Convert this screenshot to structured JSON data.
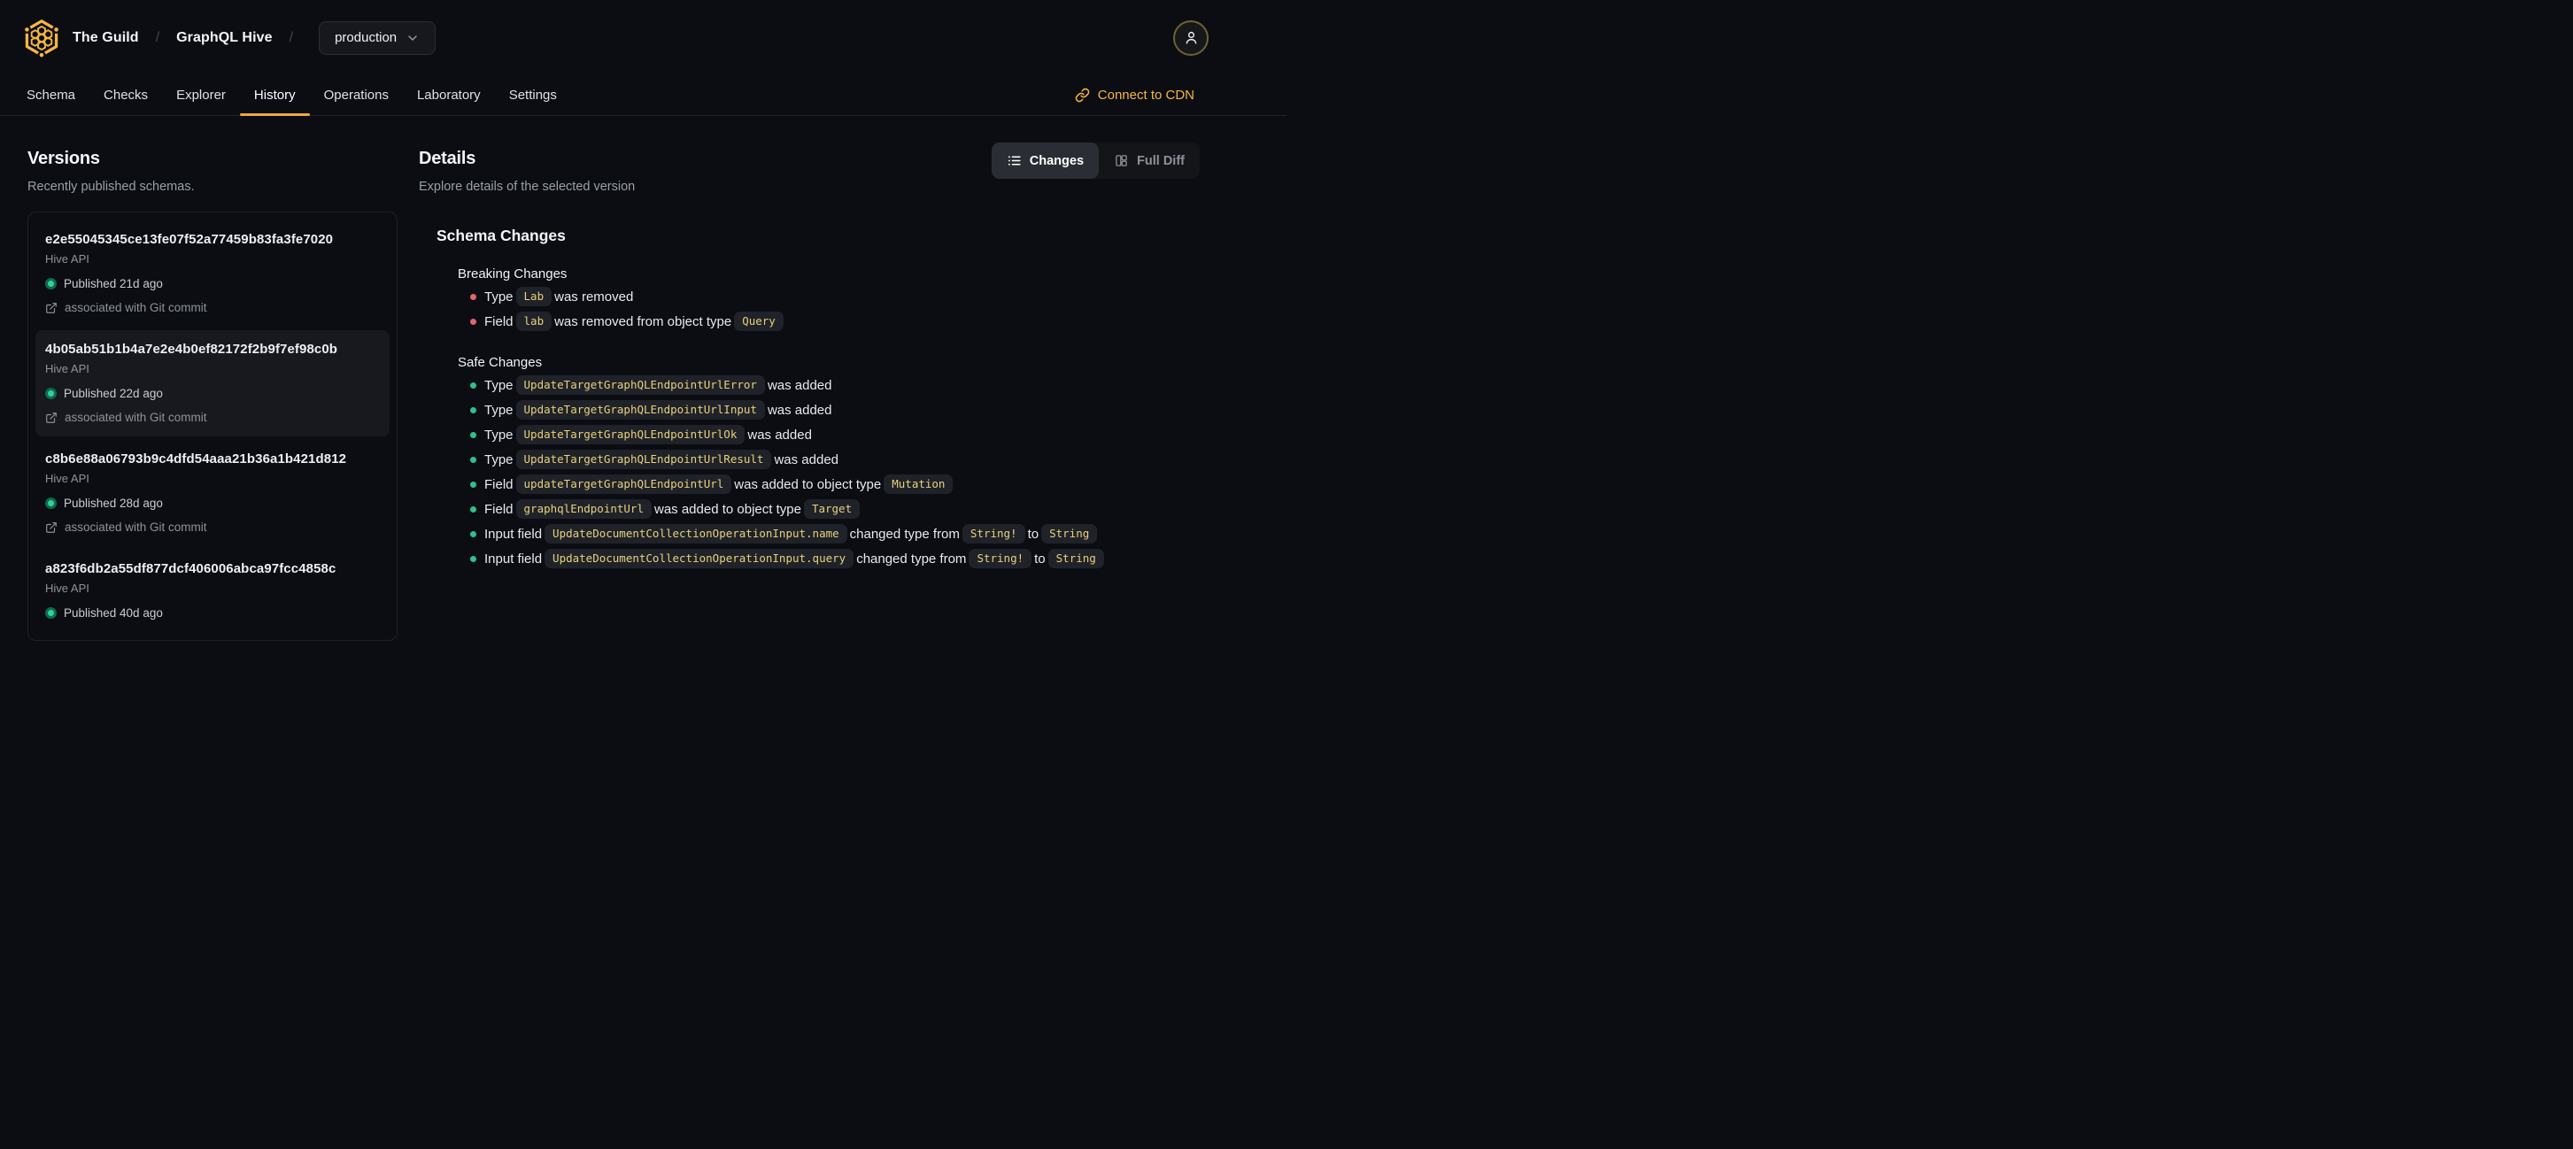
{
  "brand": {
    "org": "The Guild",
    "project": "GraphQL Hive",
    "target": "production",
    "separator": "/"
  },
  "tabs": [
    {
      "label": "Schema"
    },
    {
      "label": "Checks"
    },
    {
      "label": "Explorer"
    },
    {
      "label": "History",
      "active": true
    },
    {
      "label": "Operations"
    },
    {
      "label": "Laboratory"
    },
    {
      "label": "Settings"
    }
  ],
  "cdn_link": {
    "label": "Connect to CDN"
  },
  "versions_panel": {
    "title": "Versions",
    "subtitle": "Recently published schemas.",
    "items": [
      {
        "hash": "e2e55045345ce13fe07f52a77459b83fa3fe7020",
        "service": "Hive API",
        "published": "Published 21d ago",
        "git": "associated with Git commit",
        "selected": false
      },
      {
        "hash": "4b05ab51b1b4a7e2e4b0ef82172f2b9f7ef98c0b",
        "service": "Hive API",
        "published": "Published 22d ago",
        "git": "associated with Git commit",
        "selected": true
      },
      {
        "hash": "c8b6e88a06793b9c4dfd54aaa21b36a1b421d812",
        "service": "Hive API",
        "published": "Published 28d ago",
        "git": "associated with Git commit",
        "selected": false
      },
      {
        "hash": "a823f6db2a55df877dcf406006abca97fcc4858c",
        "service": "Hive API",
        "published": "Published 40d ago",
        "git": null,
        "selected": false
      }
    ]
  },
  "details_panel": {
    "title": "Details",
    "subtitle": "Explore details of the selected version",
    "view_toggle": [
      {
        "label": "Changes",
        "icon": "list-icon",
        "active": true
      },
      {
        "label": "Full Diff",
        "icon": "columns-icon",
        "active": false
      }
    ],
    "schema_changes": {
      "title": "Schema Changes",
      "sections": [
        {
          "title": "Breaking Changes",
          "kind": "breaking",
          "items": [
            [
              {
                "text": "Type "
              },
              {
                "code": "Lab"
              },
              {
                "text": " was removed"
              }
            ],
            [
              {
                "text": "Field "
              },
              {
                "code": "lab"
              },
              {
                "text": " was removed from object type "
              },
              {
                "code": "Query"
              }
            ]
          ]
        },
        {
          "title": "Safe Changes",
          "kind": "safe",
          "items": [
            [
              {
                "text": "Type "
              },
              {
                "code": "UpdateTargetGraphQLEndpointUrlError"
              },
              {
                "text": " was added"
              }
            ],
            [
              {
                "text": "Type "
              },
              {
                "code": "UpdateTargetGraphQLEndpointUrlInput"
              },
              {
                "text": " was added"
              }
            ],
            [
              {
                "text": "Type "
              },
              {
                "code": "UpdateTargetGraphQLEndpointUrlOk"
              },
              {
                "text": " was added"
              }
            ],
            [
              {
                "text": "Type "
              },
              {
                "code": "UpdateTargetGraphQLEndpointUrlResult"
              },
              {
                "text": " was added"
              }
            ],
            [
              {
                "text": "Field "
              },
              {
                "code": "updateTargetGraphQLEndpointUrl"
              },
              {
                "text": " was added to object type "
              },
              {
                "code": "Mutation"
              }
            ],
            [
              {
                "text": "Field "
              },
              {
                "code": "graphqlEndpointUrl"
              },
              {
                "text": " was added to object type "
              },
              {
                "code": "Target"
              }
            ],
            [
              {
                "text": "Input field "
              },
              {
                "code": "UpdateDocumentCollectionOperationInput.name"
              },
              {
                "text": " changed type from "
              },
              {
                "code": "String!"
              },
              {
                "text": " to "
              },
              {
                "code": "String"
              }
            ],
            [
              {
                "text": "Input field "
              },
              {
                "code": "UpdateDocumentCollectionOperationInput.query"
              },
              {
                "text": " changed type from "
              },
              {
                "code": "String!"
              },
              {
                "text": " to "
              },
              {
                "code": "String"
              }
            ]
          ]
        }
      ]
    }
  },
  "colors": {
    "accent": "#f4b740",
    "tab_underline": "#f0a73c",
    "breaking_bullet": "#e5646e",
    "safe_bullet": "#2fc08b",
    "published_dot": "#2fd39a",
    "published_dot_ring": "#11694c",
    "chip_text": "#e9d17c",
    "chip_bg": "#1f2228",
    "page_bg": "#0b0d12",
    "selected_card_bg": "#17191f"
  }
}
